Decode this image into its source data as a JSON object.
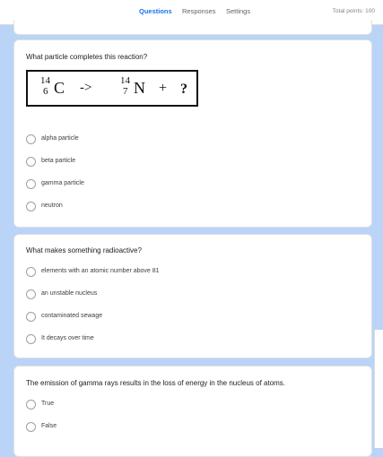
{
  "header": {
    "tabs": [
      {
        "label": "Questions",
        "active": true
      },
      {
        "label": "Responses",
        "active": false
      },
      {
        "label": "Settings",
        "active": false
      }
    ],
    "total_points": "Total points: 100"
  },
  "questions": [
    {
      "text": "What particle completes this reaction?",
      "equation": {
        "reactant": {
          "mass": "14",
          "atomic": "6",
          "symbol": "C"
        },
        "arrow": "->",
        "product": {
          "mass": "14",
          "atomic": "7",
          "symbol": "N"
        },
        "plus": "+",
        "unknown": "?"
      },
      "options": [
        "alpha particle",
        "beta particle",
        "gamma particle",
        "neutron"
      ]
    },
    {
      "text": "What makes something radioactive?",
      "options": [
        "elements with an atomic number above 81",
        "an unstable nucleus",
        "contaminated sewage",
        "It decays over time"
      ]
    },
    {
      "text": "The emission of gamma rays results in the loss of energy in the nucleus of atoms.",
      "options": [
        "True",
        "False"
      ]
    }
  ],
  "colors": {
    "accent": "#1a73e8",
    "background": "#b9d4f7",
    "card": "#ffffff"
  }
}
